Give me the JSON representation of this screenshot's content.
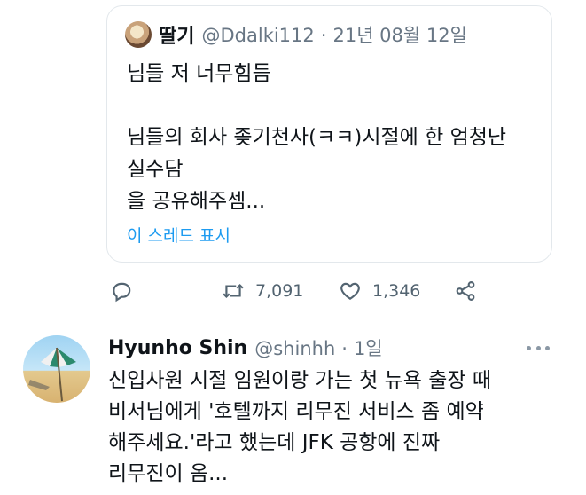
{
  "quoted_tweet": {
    "author_name": "딸기",
    "handle": "@Ddalki112",
    "separator": "·",
    "date": "21년 08월 12일",
    "lines": [
      "님들 저 너무힘듬",
      "",
      "님들의 회사 좆기천사(ㅋㅋ)시절에 한 엄청난",
      "실수담",
      "을 공유해주셈..."
    ],
    "show_thread_label": "이 스레드 표시"
  },
  "actions": {
    "reply_icon": "reply-icon",
    "retweet_icon": "retweet-icon",
    "retweet_count": "7,091",
    "like_icon": "heart-icon",
    "like_count": "1,346",
    "share_icon": "share-icon"
  },
  "reply_tweet": {
    "author_name": "Hyunho Shin",
    "handle": "@shinhh",
    "separator": "·",
    "time": "1일",
    "lines": [
      "신입사원 시절 임원이랑 가는 첫 뉴욕 출장 때",
      "비서님에게 '호텔까지 리무진 서비스 좀 예약",
      "해주세요.'라고 했는데 JFK 공항에 진짜",
      "리무진이 옴..."
    ]
  },
  "colors": {
    "link": "#1d9bf0",
    "muted": "#687684",
    "text": "#0f1419",
    "border": "#e3e8ec"
  }
}
